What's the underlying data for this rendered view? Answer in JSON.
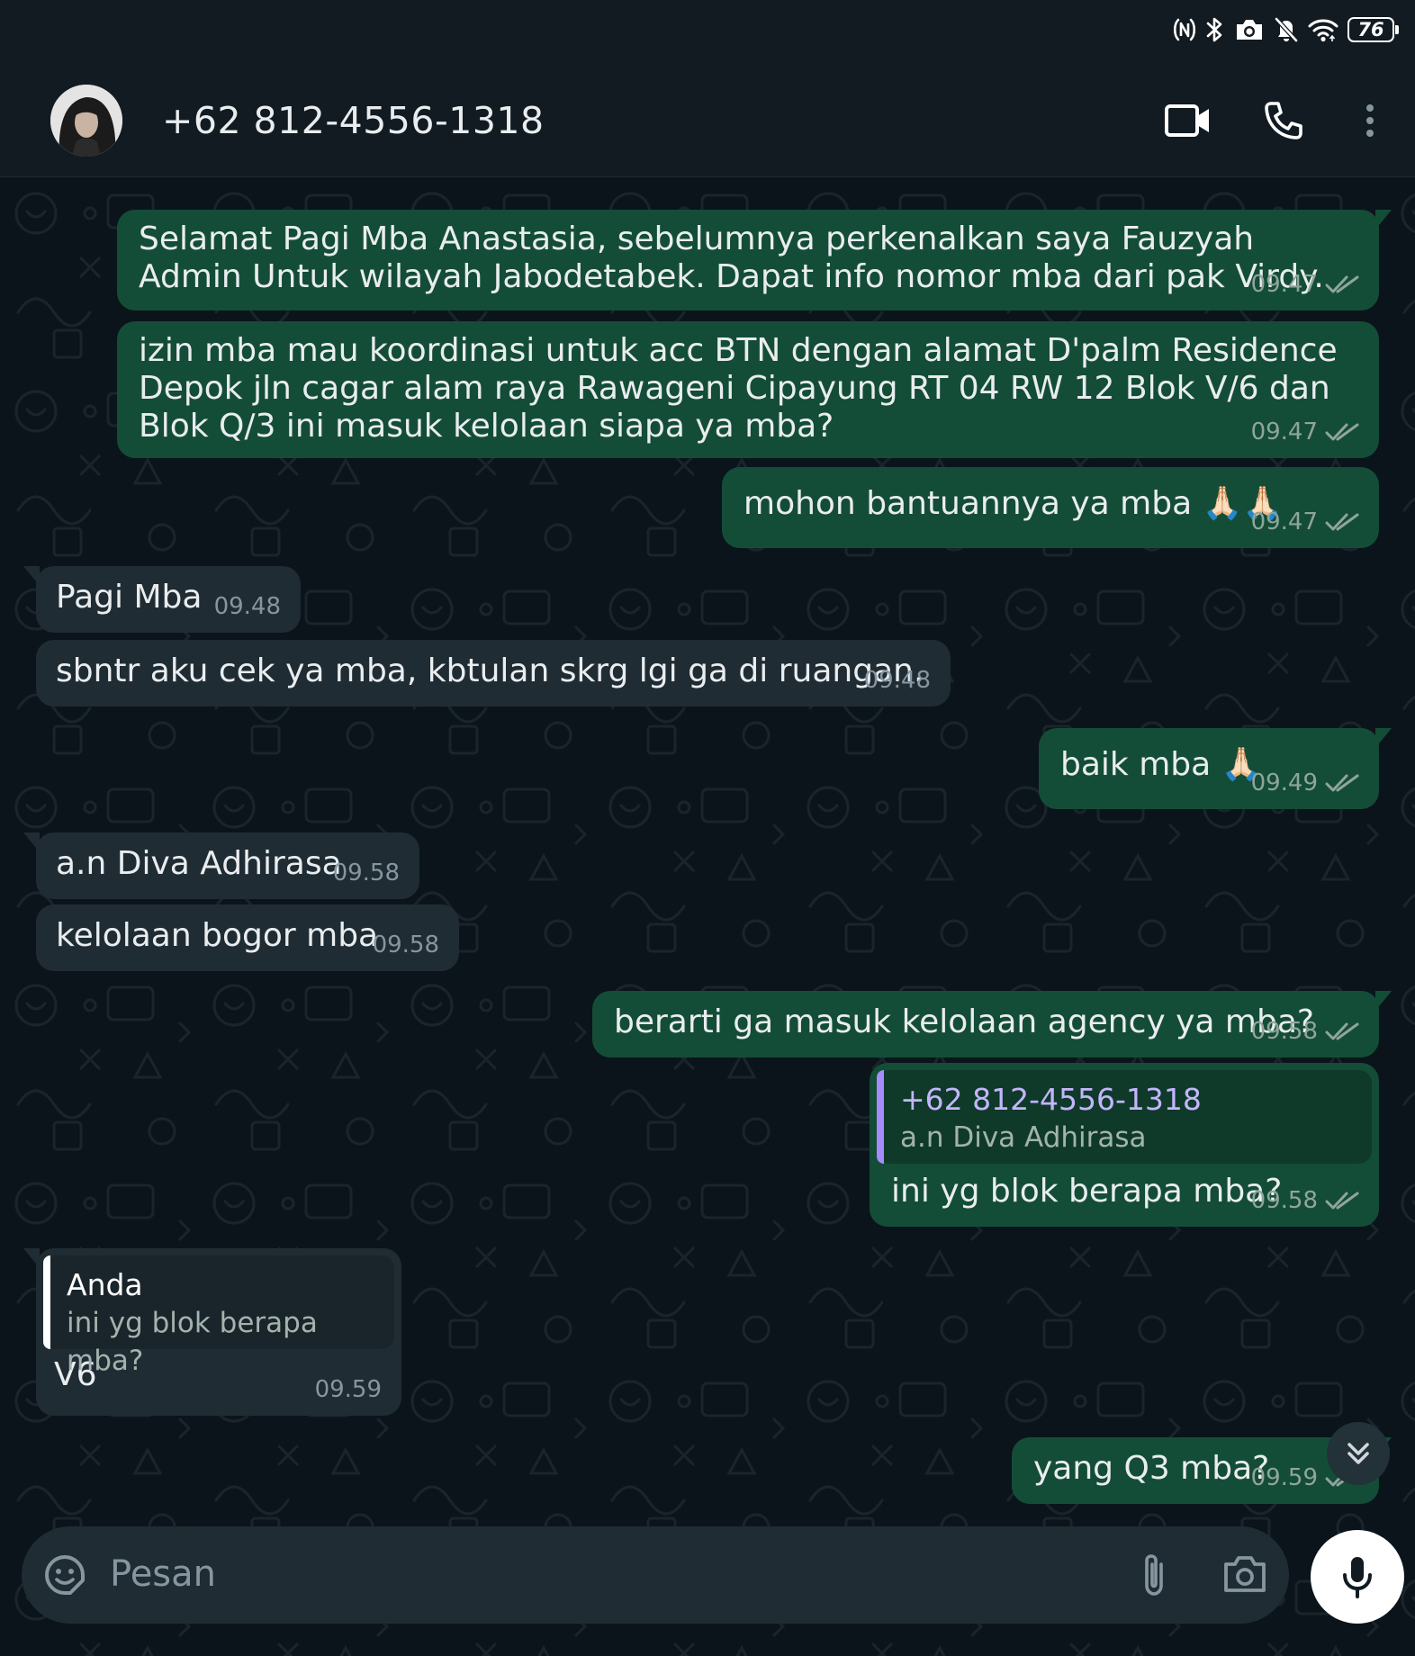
{
  "status_bar": {
    "battery_level": "76",
    "icons": [
      "nfc-icon",
      "bluetooth-icon",
      "camera-icon",
      "mute-icon",
      "wifi-icon",
      "battery-icon"
    ]
  },
  "header": {
    "contact_name": "+62 812-4556-1318",
    "icons": [
      "video-call-icon",
      "phone-icon",
      "more-vert-icon"
    ]
  },
  "messages": [
    {
      "direction": "out",
      "text": "Selamat Pagi Mba Anastasia, sebelumnya perkenalkan saya Fauzyah Admin Untuk wilayah Jabodetabek. Dapat info nomor mba dari pak Virdy.",
      "time": "09.47",
      "status": "read"
    },
    {
      "direction": "out",
      "text": "izin mba mau koordinasi untuk acc BTN dengan alamat D'palm Residence Depok jln cagar alam raya Rawageni Cipayung RT 04 RW 12 Blok V/6 dan Blok Q/3 ini masuk kelolaan siapa ya mba?",
      "time": "09.47",
      "status": "read"
    },
    {
      "direction": "out",
      "text": "mohon bantuannya ya mba 🙏🏻🙏🏻",
      "time": "09.47",
      "status": "read"
    },
    {
      "direction": "in",
      "text": "Pagi Mba",
      "time": "09.48"
    },
    {
      "direction": "in",
      "text": "sbntr aku cek ya mba, kbtulan skrg lgi ga di ruangan.",
      "time": "09.48"
    },
    {
      "direction": "out",
      "text": "baik mba 🙏🏻",
      "time": "09.49",
      "status": "read"
    },
    {
      "direction": "in",
      "text": "a.n Diva Adhirasa",
      "time": "09.58"
    },
    {
      "direction": "in",
      "text": "kelolaan bogor mba",
      "time": "09.58"
    },
    {
      "direction": "out",
      "text": "berarti ga masuk kelolaan agency ya mba?",
      "time": "09.58",
      "status": "read"
    },
    {
      "direction": "out",
      "quote_title": "+62 812-4556-1318",
      "quote_text": "a.n Diva Adhirasa",
      "text": "ini yg blok berapa mba?",
      "time": "09.58",
      "status": "read"
    },
    {
      "direction": "in",
      "quote_title": "Anda",
      "quote_text": "ini yg blok berapa mba?",
      "text": "V6",
      "time": "09.59"
    },
    {
      "direction": "out",
      "text": "yang Q3 mba?",
      "time": "09.59",
      "status": "read"
    }
  ],
  "composer": {
    "placeholder": "Pesan",
    "icons": [
      "emoji-icon",
      "attach-icon",
      "camera-icon",
      "mic-icon"
    ]
  },
  "colors": {
    "background": "#0b141a",
    "header": "#111b21",
    "outgoing_bubble": "#144d37",
    "incoming_bubble": "#202c33",
    "read_tick": "#8fa59b",
    "quote_bar_out": "#a78bfa",
    "quote_bar_in": "#ffffff"
  }
}
